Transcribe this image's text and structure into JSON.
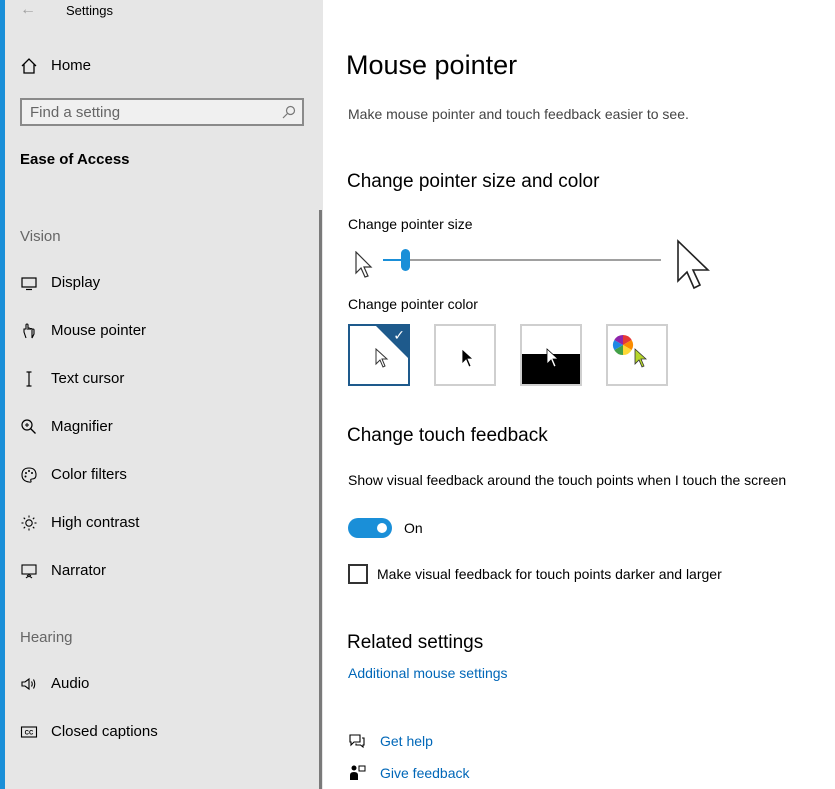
{
  "window": {
    "title": "Settings"
  },
  "sidebar": {
    "home": "Home",
    "search_placeholder": "Find a setting",
    "section": "Ease of Access",
    "groups": [
      {
        "heading": "Vision"
      },
      {
        "heading": "Hearing"
      }
    ],
    "items": [
      {
        "label": "Display",
        "icon": "display-icon"
      },
      {
        "label": "Mouse pointer",
        "icon": "mouse-pointer-icon"
      },
      {
        "label": "Text cursor",
        "icon": "text-cursor-icon"
      },
      {
        "label": "Magnifier",
        "icon": "magnifier-icon"
      },
      {
        "label": "Color filters",
        "icon": "color-filters-icon"
      },
      {
        "label": "High contrast",
        "icon": "high-contrast-icon"
      },
      {
        "label": "Narrator",
        "icon": "narrator-icon"
      },
      {
        "label": "Audio",
        "icon": "audio-icon"
      },
      {
        "label": "Closed captions",
        "icon": "closed-captions-icon"
      }
    ],
    "active_item": "Mouse pointer"
  },
  "main": {
    "title": "Mouse pointer",
    "description": "Make mouse pointer and touch feedback easier to see.",
    "pointer_section": {
      "heading": "Change pointer size and color",
      "size_label": "Change pointer size",
      "size_value_fraction": 0.08,
      "color_label": "Change pointer color",
      "color_options": [
        "white",
        "black",
        "inverted",
        "custom"
      ],
      "selected_color": "white"
    },
    "touch_section": {
      "heading": "Change touch feedback",
      "feedback_label": "Show visual feedback around the touch points when I touch the screen",
      "toggle_state": "On",
      "darker_label": "Make visual feedback for touch points darker and larger",
      "darker_checked": false
    },
    "related": {
      "heading": "Related settings",
      "link": "Additional mouse settings"
    },
    "help": {
      "get_help": "Get help",
      "give_feedback": "Give feedback"
    }
  },
  "colors": {
    "accent": "#1a8fd8",
    "link": "#0067b8",
    "selected_border": "#1e5a8c"
  }
}
